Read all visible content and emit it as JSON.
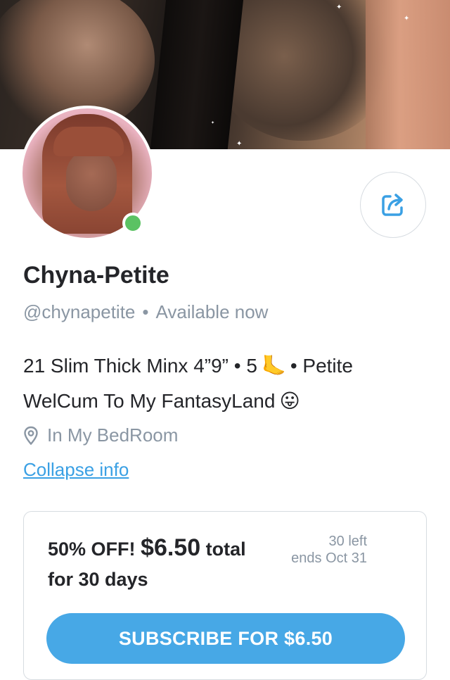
{
  "profile": {
    "name": "Chyna-Petite",
    "handle": "@chynapetite",
    "status": "Available now",
    "bio_line1_part1": "21 Slim Thick Minx 4”9” • 5",
    "bio_line1_emoji": "🦶",
    "bio_line1_part2": "• Petite",
    "bio_line2_text": "WelCum To My FantasyLand",
    "bio_line2_emoji": "😛",
    "location": "In My BedRoom",
    "collapse_label": "Collapse info",
    "online": true
  },
  "offer": {
    "discount_label": "50% OFF!",
    "price": "$6.50",
    "total_label": "total",
    "duration": "for 30 days",
    "remaining": "30 left",
    "ends": "ends Oct 31",
    "subscribe_label": "SUBSCRIBE FOR $6.50"
  },
  "colors": {
    "accent": "#47a8e6",
    "link": "#3aa0e4",
    "online": "#5bc263",
    "muted": "#8a96a3",
    "text": "#242529"
  },
  "icons": {
    "share": "share-icon",
    "location": "location-pin-icon"
  }
}
